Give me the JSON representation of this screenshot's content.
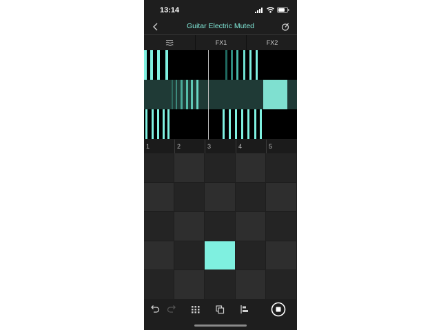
{
  "status_bar": {
    "time": "13:14"
  },
  "header": {
    "title": "Guitar Electric Muted"
  },
  "tabs": [
    {
      "label": "",
      "icon": "eq-lines-icon"
    },
    {
      "label": "FX1"
    },
    {
      "label": "FX2"
    }
  ],
  "ruler": {
    "bars": [
      "1",
      "2",
      "3",
      "4",
      "5"
    ]
  },
  "pads": {
    "rows": 5,
    "cols": 5,
    "active": [
      {
        "row": 4,
        "col": 3
      }
    ]
  },
  "toolbar": {
    "items": [
      "undo-icon",
      "redo-icon",
      "grid-icon",
      "duplicate-icon",
      "align-icon",
      "record-stop-icon"
    ]
  },
  "colors": {
    "accent": "#7ff0e0",
    "accent_dark": "#1f3a36",
    "background": "#1e1e1e",
    "pad_dark": "#242424",
    "pad_light": "#2e2e2e"
  }
}
